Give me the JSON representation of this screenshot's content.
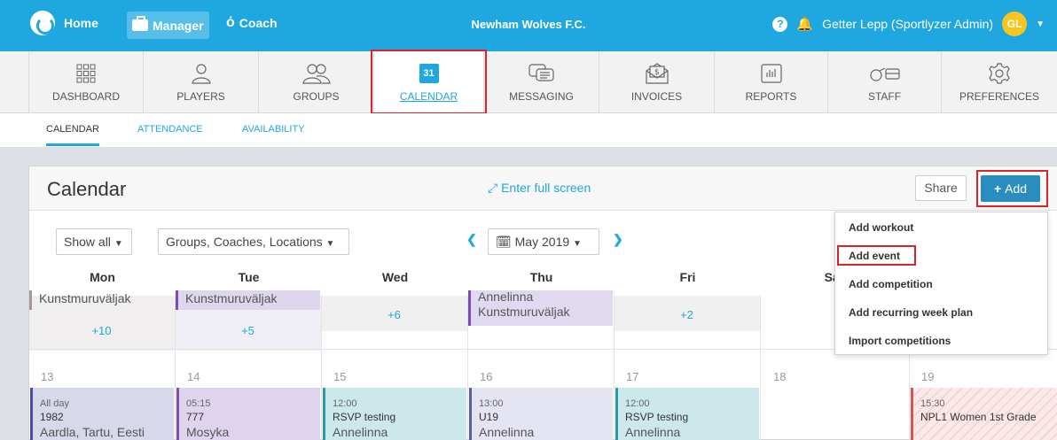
{
  "topbar": {
    "home_label": "Home",
    "manager_label": "Manager",
    "coach_label": "Coach",
    "club_name": "Newham Wolves F.C.",
    "user_name": "Getter Lepp (Sportlyzer Admin)",
    "avatar_initials": "GL",
    "bg_color": "#1fa7e0"
  },
  "modules": [
    {
      "label": "DASHBOARD",
      "icon": "grid-icon"
    },
    {
      "label": "PLAYERS",
      "icon": "person-icon"
    },
    {
      "label": "GROUPS",
      "icon": "group-icon"
    },
    {
      "label": "CALENDAR",
      "icon": "calendar-icon",
      "icon_text": "31",
      "active": true
    },
    {
      "label": "MESSAGING",
      "icon": "chat-icon"
    },
    {
      "label": "INVOICES",
      "icon": "invoice-icon"
    },
    {
      "label": "REPORTS",
      "icon": "chart-icon"
    },
    {
      "label": "STAFF",
      "icon": "whistle-icon"
    },
    {
      "label": "PREFERENCES",
      "icon": "gear-icon"
    }
  ],
  "subnav": [
    "CALENDAR",
    "ATTENDANCE",
    "AVAILABILITY"
  ],
  "panel": {
    "title": "Calendar",
    "fullscreen_label": "Enter full screen",
    "share_label": "Share",
    "add_label": "Add"
  },
  "filters": {
    "show_all": "Show all",
    "groups": "Groups, Coaches, Locations",
    "month": "May 2019"
  },
  "days": [
    "Mon",
    "Tue",
    "Wed",
    "Thu",
    "Fri",
    "Sat"
  ],
  "week1": {
    "mon_partial": "Kunstmuruväljak",
    "mon_more": "+10",
    "tue_partial": "Kunstmuruväljak",
    "tue_more": "+5",
    "wed_more": "+6",
    "thu_partial_top": "Annelinna",
    "thu_partial": "Kunstmuruväljak",
    "fri_more": "+2"
  },
  "week2": {
    "day_numbers": [
      "13",
      "14",
      "15",
      "16",
      "17",
      "18",
      "19"
    ],
    "events": [
      {
        "time": "All day",
        "name": "1982",
        "location": "Aardla, Tartu, Eesti"
      },
      {
        "time": "05:15",
        "name": "777",
        "location": "Mosyka"
      },
      {
        "time": "12:00",
        "name": "RSVP testing",
        "location": "Annelinna"
      },
      {
        "time": "13:00",
        "name": "U19",
        "location": "Annelinna"
      },
      {
        "time": "12:00",
        "name": "RSVP testing",
        "location": "Annelinna"
      },
      {
        "time": "15:30",
        "name": "NPL1 Women 1st Grade",
        "location": ""
      }
    ]
  },
  "add_menu": [
    "Add workout",
    "Add event",
    "Add competition",
    "Add recurring week plan",
    "Import competitions"
  ]
}
